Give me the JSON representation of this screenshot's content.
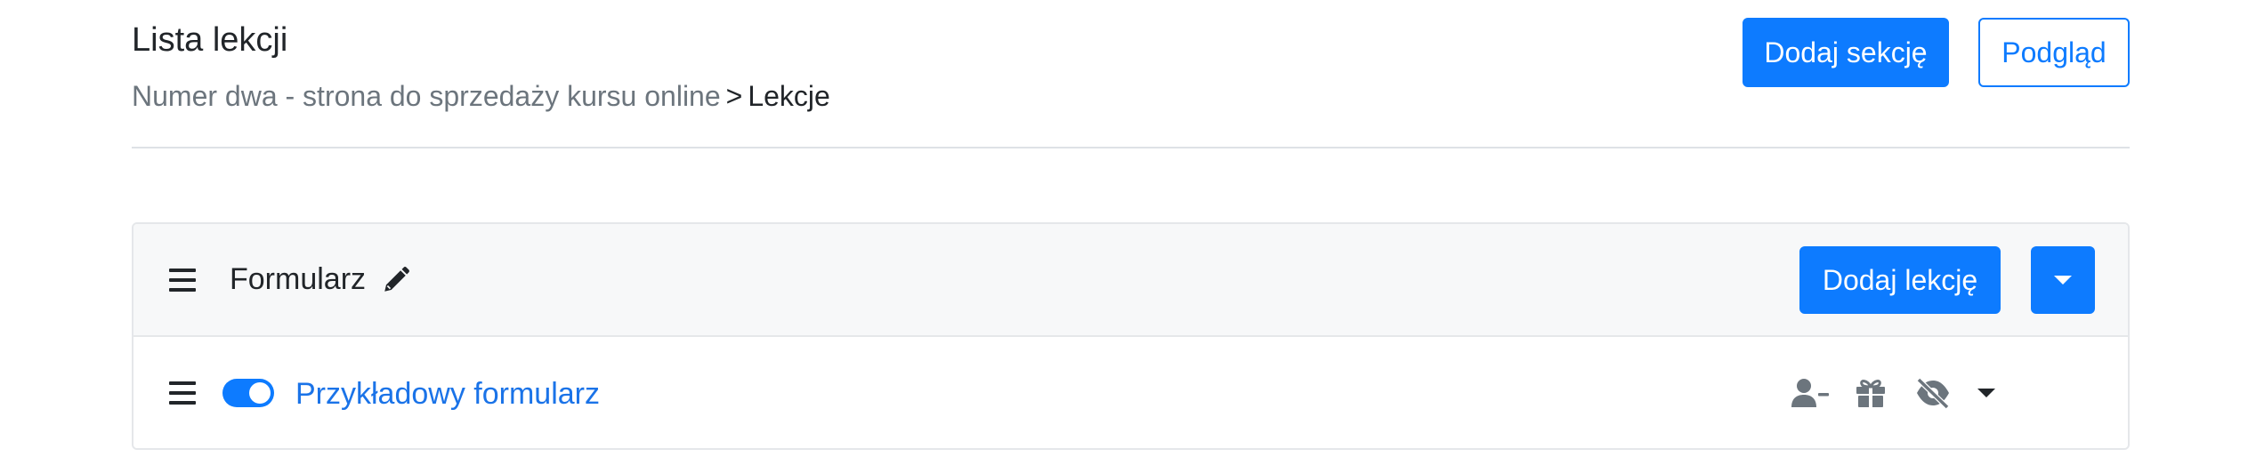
{
  "header": {
    "title": "Lista lekcji",
    "breadcrumb": {
      "parent": "Numer dwa - strona do sprzedaży kursu online",
      "separator": ">",
      "current": "Lekcje"
    },
    "add_section_label": "Dodaj sekcję",
    "preview_label": "Podgląd"
  },
  "section": {
    "title": "Formularz",
    "add_lesson_label": "Dodaj lekcję",
    "lessons": [
      {
        "title": "Przykładowy formularz",
        "published": true
      }
    ]
  },
  "icons": {
    "drag": "bars-icon",
    "edit": "pencil-icon",
    "user": "user-minus-icon",
    "gift": "gift-icon",
    "visibility": "eye-slash-icon",
    "dropdown": "caret-down-icon"
  },
  "colors": {
    "accent": "#0d7bff",
    "link": "#1a73e8",
    "muted_icon": "#6c757d"
  }
}
